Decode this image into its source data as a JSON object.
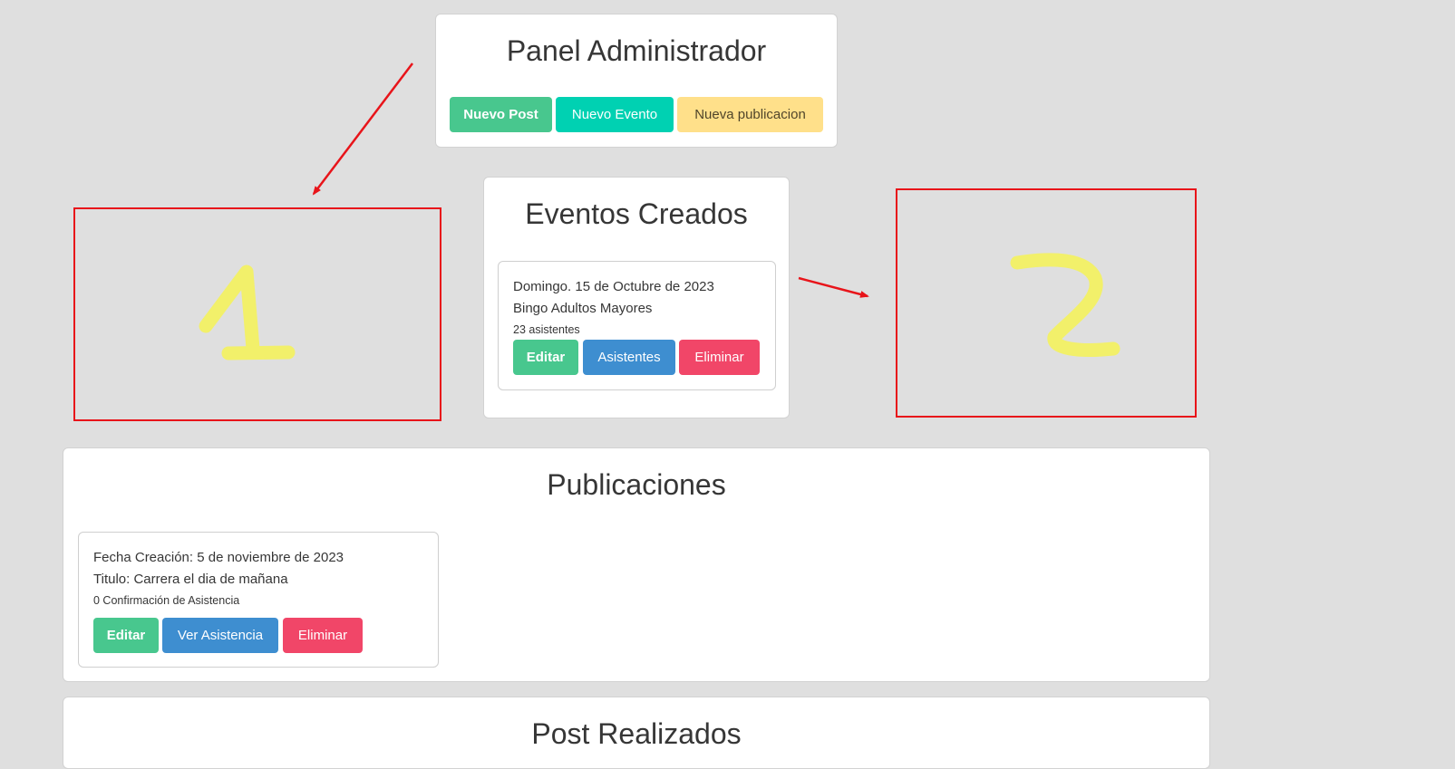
{
  "admin_panel": {
    "title": "Panel Administrador",
    "buttons": {
      "new_post": "Nuevo Post",
      "new_event": "Nuevo Evento",
      "new_publication": "Nueva publicacion"
    }
  },
  "events_panel": {
    "title": "Eventos Creados",
    "events": [
      {
        "date": "Domingo. 15 de Octubre de 2023",
        "name": "Bingo Adultos Mayores",
        "attendees": "23 asistentes",
        "edit_label": "Editar",
        "attendees_label": "Asistentes",
        "delete_label": "Eliminar"
      }
    ]
  },
  "publications_panel": {
    "title": "Publicaciones",
    "publications": [
      {
        "created": "Fecha Creación: 5 de noviembre de 2023",
        "title": "Titulo: Carrera el dia de mañana",
        "confirmations": "0 Confirmación de Asistencia",
        "edit_label": "Editar",
        "view_attendance_label": "Ver Asistencia",
        "delete_label": "Eliminar"
      }
    ]
  },
  "posts_panel": {
    "title": "Post Realizados"
  },
  "annotations": {
    "color_red": "#e8141a",
    "color_yellow": "#f2f06a",
    "marker_1": "1",
    "marker_2": "2"
  },
  "colors": {
    "background": "#dfdfdf",
    "success": "#48c78e",
    "primary": "#00d1b2",
    "warning": "#ffe08a",
    "info": "#3e8ed0",
    "danger": "#f14668"
  }
}
